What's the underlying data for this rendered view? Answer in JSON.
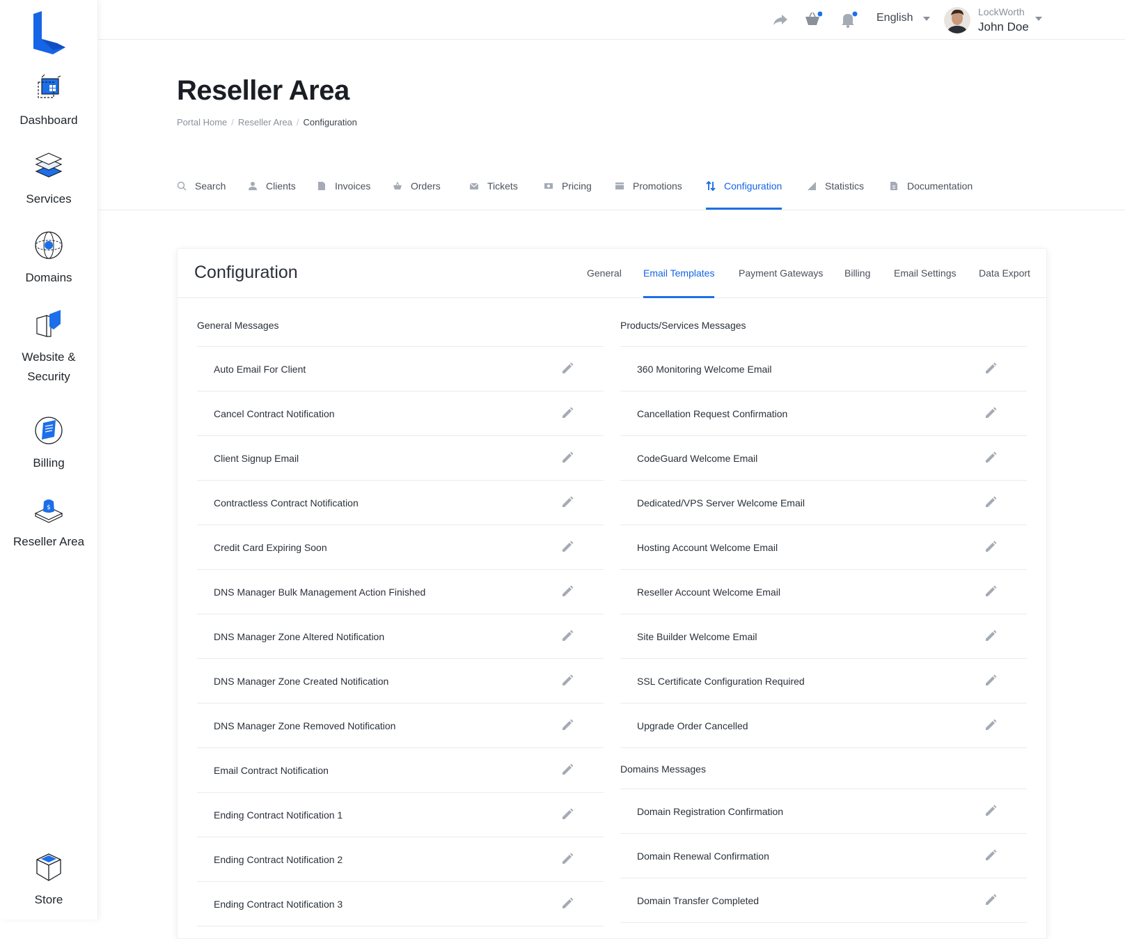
{
  "sidebar": {
    "items": [
      {
        "label": "Dashboard",
        "icon": "dashboard-icon"
      },
      {
        "label": "Services",
        "icon": "services-icon"
      },
      {
        "label": "Domains",
        "icon": "domains-icon"
      },
      {
        "label": "Website &",
        "label2": "Security",
        "icon": "website-security-icon"
      },
      {
        "label": "Billing",
        "icon": "billing-icon"
      },
      {
        "label": "Reseller Area",
        "icon": "reseller-area-icon"
      }
    ],
    "store": {
      "label": "Store",
      "icon": "store-icon"
    }
  },
  "topbar": {
    "language": "English",
    "user": {
      "company": "LockWorth",
      "name": "John Doe"
    },
    "icons": [
      "share-icon",
      "cart-icon",
      "bell-icon"
    ],
    "accent": "#1c6fe8"
  },
  "page": {
    "title": "Reseller Area",
    "breadcrumb": [
      "Portal Home",
      "Reseller Area",
      "Configuration"
    ]
  },
  "main_tabs": [
    {
      "label": "Search",
      "icon": "search-icon"
    },
    {
      "label": "Clients",
      "icon": "user-icon"
    },
    {
      "label": "Invoices",
      "icon": "file-icon"
    },
    {
      "label": "Orders",
      "icon": "basket-icon"
    },
    {
      "label": "Tickets",
      "icon": "envelope-icon"
    },
    {
      "label": "Pricing",
      "icon": "money-icon"
    },
    {
      "label": "Promotions",
      "icon": "promo-icon"
    },
    {
      "label": "Configuration",
      "icon": "config-arrows-icon",
      "active": true
    },
    {
      "label": "Statistics",
      "icon": "chart-triangle-icon"
    },
    {
      "label": "Documentation",
      "icon": "doc-icon"
    }
  ],
  "card": {
    "title": "Configuration",
    "tabs": [
      {
        "label": "General"
      },
      {
        "label": "Email Templates",
        "active": true
      },
      {
        "label": "Payment Gateways"
      },
      {
        "label": "Billing"
      },
      {
        "label": "Email Settings"
      },
      {
        "label": "Data Export"
      }
    ],
    "general": {
      "title": "General Messages",
      "items": [
        "Auto Email For Client",
        "Cancel Contract Notification",
        "Client Signup Email",
        "Contractless Contract Notification",
        "Credit Card Expiring Soon",
        "DNS Manager Bulk Management Action Finished",
        "DNS Manager Zone Altered Notification",
        "DNS Manager Zone Created Notification",
        "DNS Manager Zone Removed Notification",
        "Email Contract Notification",
        "Ending Contract Notification 1",
        "Ending Contract Notification 2",
        "Ending Contract Notification 3"
      ]
    },
    "products": {
      "title": "Products/Services Messages",
      "items": [
        "360 Monitoring Welcome Email",
        "Cancellation Request Confirmation",
        "CodeGuard Welcome Email",
        "Dedicated/VPS Server Welcome Email",
        "Hosting Account Welcome Email",
        "Reseller Account Welcome Email",
        "Site Builder Welcome Email",
        "SSL Certificate Configuration Required",
        "Upgrade Order Cancelled"
      ]
    },
    "domains": {
      "title": "Domains Messages",
      "items": [
        "Domain Registration Confirmation",
        "Domain Renewal Confirmation",
        "Domain Transfer Completed"
      ]
    }
  }
}
